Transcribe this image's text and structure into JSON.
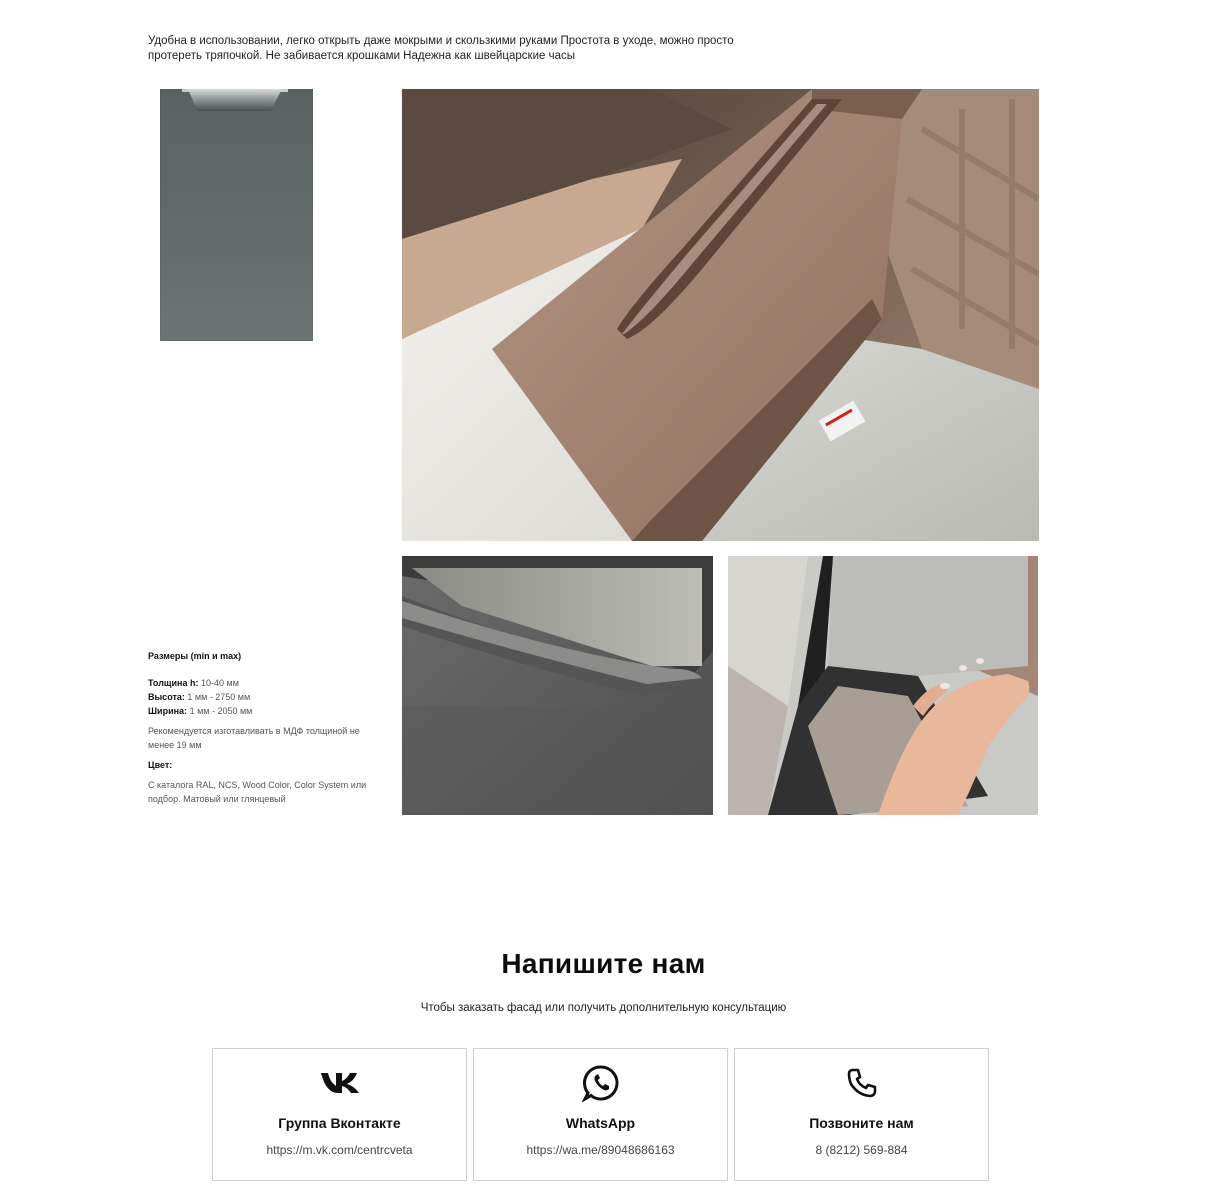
{
  "intro": {
    "text": "Удобна в использовании, легко открыть даже мокрыми и скользкими руками Простота в уходе, можно просто протереть тряпочкой. Не забивается крошками Надежна как швейцарские часы"
  },
  "specs": {
    "sizes_heading": "Размеры (min и max)",
    "thickness_label": "Толщина h:",
    "thickness_value": "10-40 мм",
    "height_label": "Высота:",
    "height_value": "1 мм - 2750 мм",
    "width_label": "Ширина:",
    "width_value": "1 мм - 2050 мм",
    "recommendation": "Рекомендуется изготавливать в МДФ толщиной не менее 19 мм",
    "color_heading": "Цвет:",
    "color_text": "С каталога RAL, NCS, Wood Color, Color System или подбор. Матовый или глянцевый"
  },
  "contact": {
    "title": "Напишите нам",
    "subtitle": "Чтобы заказать фасад или получить дополнительную консультацию",
    "cards": [
      {
        "icon": "vk-icon",
        "title": "Группа Вконтакте",
        "link": "https://m.vk.com/centrcveta"
      },
      {
        "icon": "whatsapp-icon",
        "title": "WhatsApp",
        "link": "https://wa.me/89048686163"
      },
      {
        "icon": "phone-icon",
        "title": "Позвоните нам",
        "link": "8 (8212) 569-884"
      }
    ]
  },
  "colors": {
    "door": "#606868",
    "mdf": "#9c7f6c",
    "border": "#cfcfcf"
  }
}
